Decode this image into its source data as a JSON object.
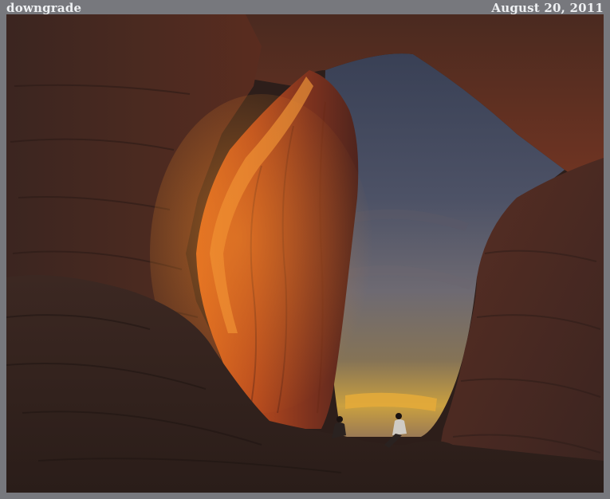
{
  "header": {
    "left_caption": "downgrade",
    "right_caption": "August 20, 2011"
  },
  "photo": {
    "subject": "",
    "colors": {
      "rock_dark": "#2f201b",
      "rock_mid": "#5a3125",
      "rock_lit": "#c15a20",
      "sky_top": "#4a5063",
      "sky_mid": "#66687a",
      "sky_glow": "#d9a232",
      "frame": "#77787d"
    }
  }
}
